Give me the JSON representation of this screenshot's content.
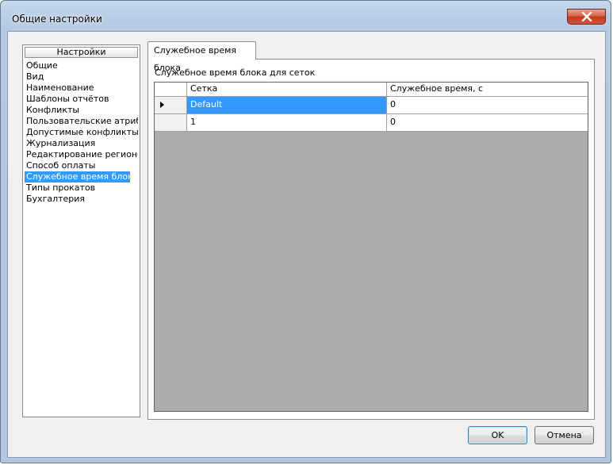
{
  "window": {
    "title": "Общие настройки"
  },
  "sidebar": {
    "header": "Настройки",
    "items": [
      {
        "label": "Общие"
      },
      {
        "label": "Вид"
      },
      {
        "label": "Наименование"
      },
      {
        "label": "Шаблоны отчётов"
      },
      {
        "label": "Конфликты"
      },
      {
        "label": "Пользовательские атриб…"
      },
      {
        "label": "Допустимые конфликты"
      },
      {
        "label": "Журнализация"
      },
      {
        "label": "Редактирование регионов"
      },
      {
        "label": "Способ оплаты"
      },
      {
        "label": "Служебное время блока",
        "selected": true
      },
      {
        "label": "Типы прокатов"
      },
      {
        "label": "Бухгалтерия"
      }
    ]
  },
  "tabs": [
    {
      "label": "Служебное время блока",
      "active": true
    }
  ],
  "panel": {
    "group_label": "Служебное время блока для сеток",
    "table": {
      "columns": [
        "Сетка",
        "Служебное время, с"
      ],
      "rows": [
        {
          "grid": "Default",
          "time": "0",
          "current": true
        },
        {
          "grid": "1",
          "time": "0",
          "current": false
        }
      ]
    }
  },
  "buttons": {
    "ok": "OK",
    "cancel": "Отмена"
  },
  "icons": {
    "close": "close-icon",
    "row_marker": "current-row-arrow-icon"
  },
  "colors": {
    "selection": "#3399ff",
    "grid_background": "#ababab",
    "close_button": "#c2391c"
  }
}
